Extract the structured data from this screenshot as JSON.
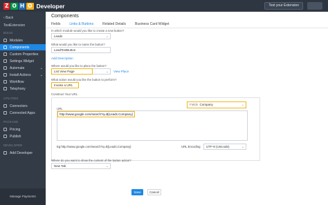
{
  "topbar": {
    "logo_letters": [
      "Z",
      "O",
      "H",
      "O"
    ],
    "app_name": "Developer",
    "test_button": "Test your Extension"
  },
  "sidebar": {
    "back": "Back",
    "extension_name": "TestExtension",
    "sections": {
      "build": "BUILD",
      "utilities": "UTILITIES",
      "package": "PACKAGE",
      "developer": "DEVELOPER"
    },
    "items": [
      {
        "label": "Modules"
      },
      {
        "label": "Components",
        "active": true
      },
      {
        "label": "Custom Properties"
      },
      {
        "label": "Settings Widget"
      },
      {
        "label": "Automate"
      },
      {
        "label": "Install Actions"
      },
      {
        "label": "Workflow"
      },
      {
        "label": "Telephony"
      },
      {
        "label": "Connectors"
      },
      {
        "label": "Connected Apps"
      },
      {
        "label": "Pricing"
      },
      {
        "label": "Publish"
      },
      {
        "label": "Add Developer"
      }
    ],
    "manage_payments": "Manage Payments"
  },
  "main": {
    "title": "Components",
    "tabs": [
      "Fields",
      "Links & Buttons",
      "Related Details",
      "Business Card Widget"
    ],
    "active_tab": 1,
    "q_module": "In which module would you like to create a new button?",
    "module_value": "Leads",
    "q_name": "What would you like to name the button?",
    "name_value": "LeadTestButton",
    "add_description": "Add Description",
    "q_place": "Where would you like to place the button?",
    "place_value": "List View Page",
    "view_place": "View Place",
    "q_action": "What action would you like the button to perform?",
    "action_value": "Invoke a URL",
    "construct_label": "Construct Your URL",
    "url_label": "URL",
    "fields_label": "Fields",
    "fields_value": "Company",
    "url_value": "http://www.google.com/search?q=${Leads.Company}",
    "url_example": "Eg:http://www.google.com/search?q=${Leads.Company}",
    "url_encoding_label": "URL Encoding",
    "url_encoding_value": "UTF-8 (Unicode)",
    "q_show": "Where do you want to show the content of the button action?",
    "show_value": "New Tab",
    "save": "Save",
    "cancel": "Cancel"
  },
  "colors": {
    "sidebar_bg": "#333b47",
    "accent": "#1e88e5",
    "highlight": "#f1b51c",
    "topbar_bg": "#2e3642"
  }
}
